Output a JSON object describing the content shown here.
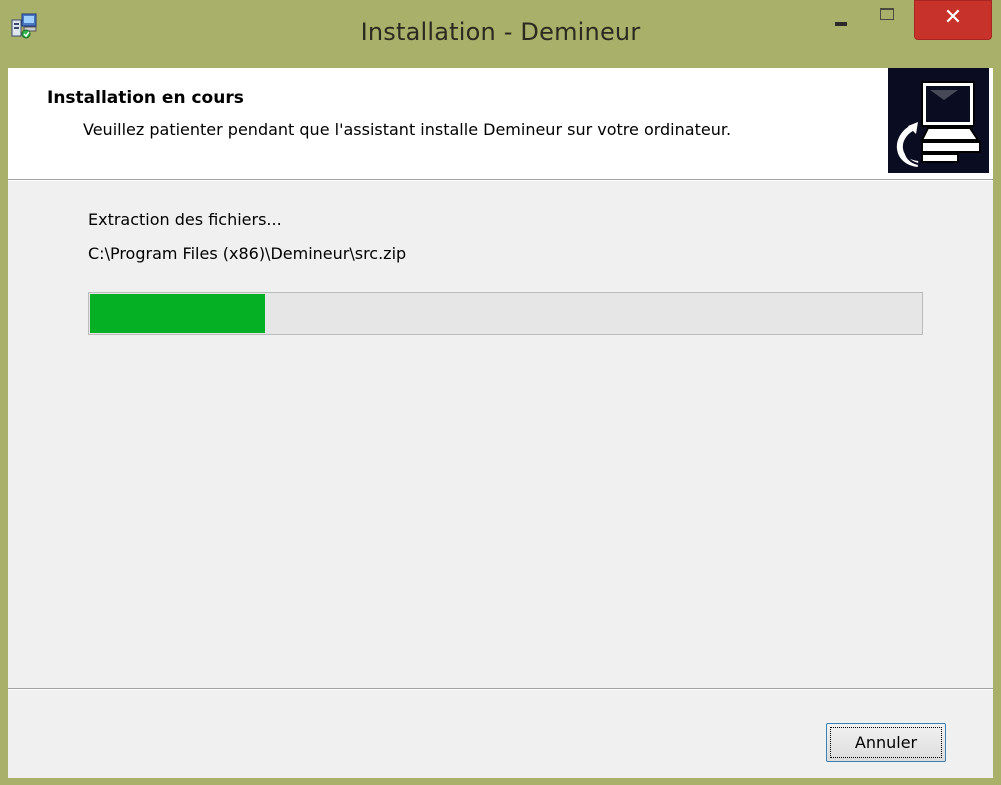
{
  "window": {
    "title": "Installation - Demineur",
    "close_glyph": "✕"
  },
  "header": {
    "title": "Installation en cours",
    "subtitle": "Veuillez patienter pendant que l'assistant installe Demineur sur votre ordinateur."
  },
  "progress": {
    "status": "Extraction des fichiers...",
    "current_file": "C:\\Program Files (x86)\\Demineur\\src.zip",
    "fraction": 0.21
  },
  "buttons": {
    "cancel_label": "Annuler"
  },
  "icons": {
    "app": "setup-icon",
    "header": "computer-install-icon"
  },
  "colors": {
    "titlebar": "#a8b06a",
    "close": "#c7332a",
    "progress_fill": "#06b025",
    "header_image_bg": "#0a0c22"
  }
}
